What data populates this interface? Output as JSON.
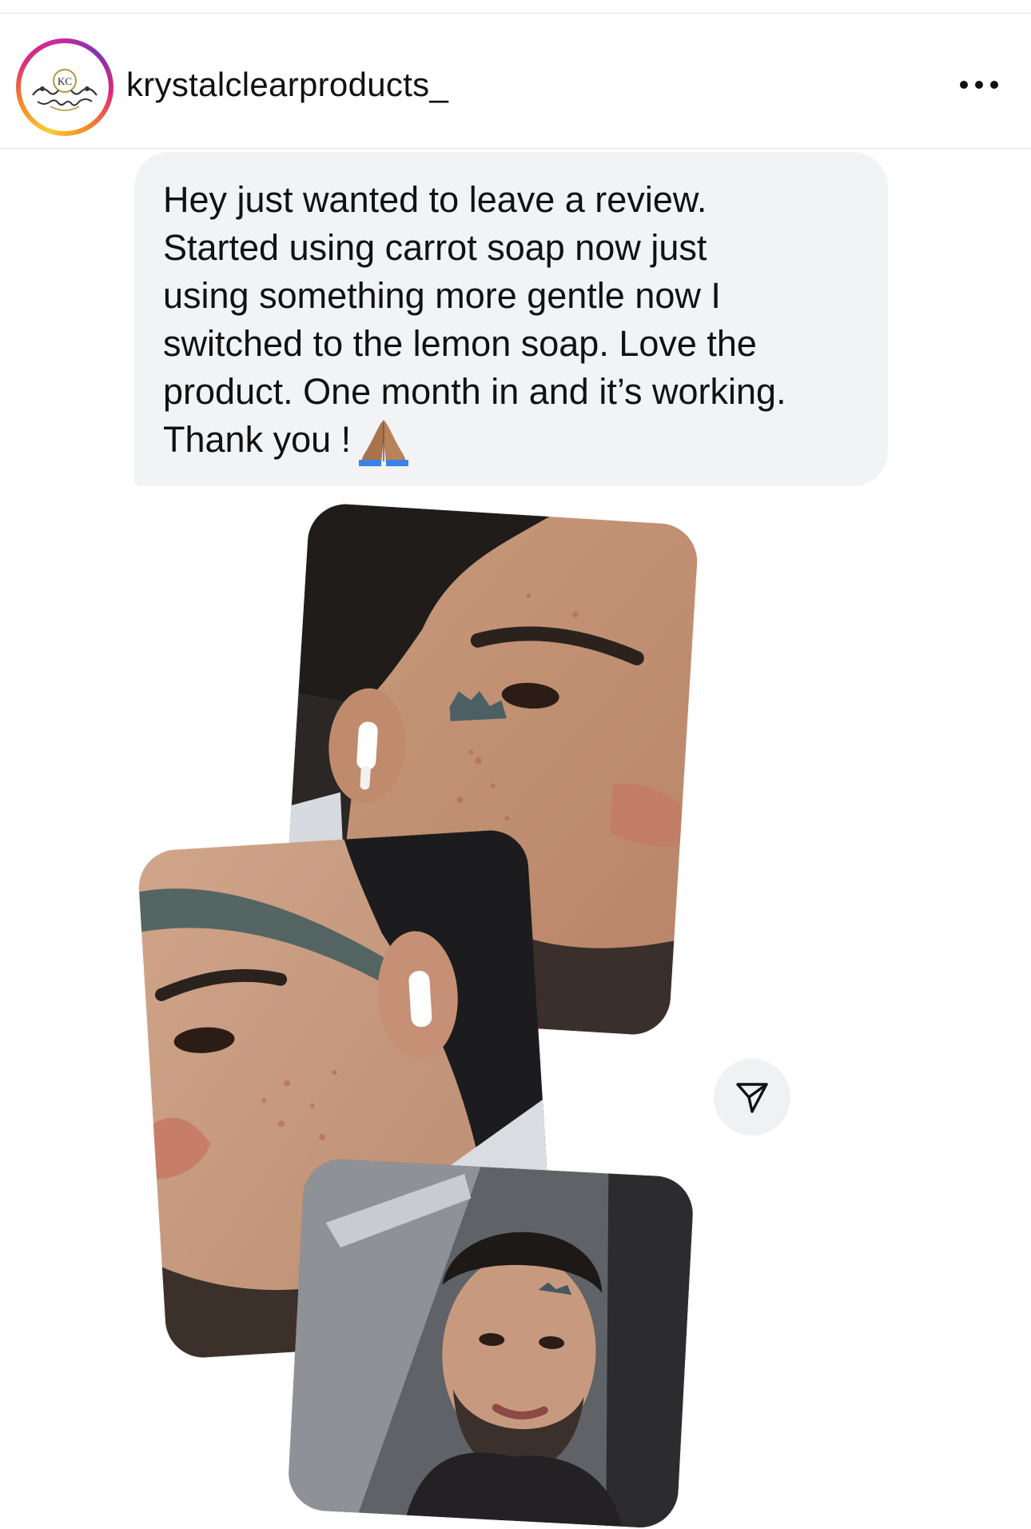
{
  "header": {
    "username": "krystalclearproducts_",
    "avatar_monogram": "KC",
    "more_icon": "more-horizontal-icon"
  },
  "message": {
    "lines": [
      "Hey just wanted to leave a review.",
      "Started using carrot soap now just",
      "using something more gentle now I",
      "switched to the lemon soap. Love the",
      "product. One month in and it’s working.",
      "Thank you !"
    ],
    "emoji": "folded-hands-icon",
    "bubble_color": "#f2f3f5"
  },
  "photos": [
    {
      "icon": "photo-face-closeup-right"
    },
    {
      "icon": "photo-face-closeup-left"
    },
    {
      "icon": "photo-selfie-car"
    }
  ],
  "actions": {
    "share_icon": "share-send-icon"
  },
  "colors": {
    "ring_start": "#f9ce34",
    "ring_mid": "#dd2a7b",
    "ring_end": "#8134af",
    "logo_gold": "#b8963f"
  }
}
